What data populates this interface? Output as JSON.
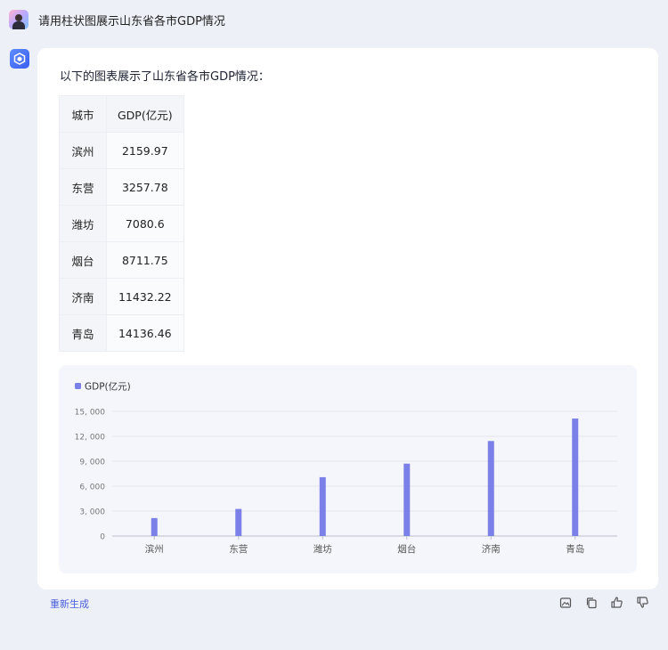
{
  "user_message": "请用柱状图展示山东省各市GDP情况",
  "assistant": {
    "intro": "以下的图表展示了山东省各市GDP情况：",
    "table": {
      "headers": [
        "城市",
        "GDP(亿元)"
      ],
      "rows": [
        [
          "滨州",
          "2159.97"
        ],
        [
          "东营",
          "3257.78"
        ],
        [
          "潍坊",
          "7080.6"
        ],
        [
          "烟台",
          "8711.75"
        ],
        [
          "济南",
          "11432.22"
        ],
        [
          "青岛",
          "14136.46"
        ]
      ]
    }
  },
  "chart_data": {
    "type": "bar",
    "categories": [
      "滨州",
      "东营",
      "潍坊",
      "烟台",
      "济南",
      "青岛"
    ],
    "series": [
      {
        "name": "GDP(亿元)",
        "values": [
          2159.97,
          3257.78,
          7080.6,
          8711.75,
          11432.22,
          14136.46
        ]
      }
    ],
    "yticks": [
      "0",
      "3, 000",
      "6, 000",
      "9, 000",
      "12, 000",
      "15, 000"
    ],
    "ylim": [
      0,
      15000
    ],
    "grid": true,
    "legend": "top-left",
    "bar_color": "#7b80e8"
  },
  "footer": {
    "regenerate": "重新生成"
  },
  "icons": [
    "image-icon",
    "copy-icon",
    "thumbs-up-icon",
    "thumbs-down-icon"
  ]
}
